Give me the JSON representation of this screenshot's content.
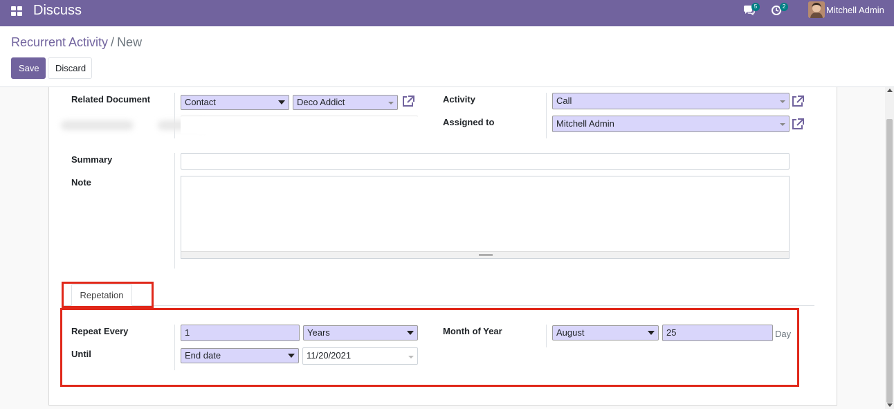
{
  "navbar": {
    "app_name": "Discuss",
    "messages_badge": "5",
    "activities_badge": "2",
    "user_name": "Mitchell Admin",
    "color": "#71639e"
  },
  "breadcrumb": {
    "parent": "Recurrent Activity",
    "separator": "/",
    "current": "New"
  },
  "buttons": {
    "save": "Save",
    "discard": "Discard"
  },
  "form": {
    "related_document": {
      "label": "Related Document",
      "model": "Contact",
      "record": "Deco Addict"
    },
    "activity": {
      "label": "Activity",
      "value": "Call"
    },
    "assigned_to": {
      "label": "Assigned to",
      "value": "Mitchell Admin"
    },
    "summary": {
      "label": "Summary",
      "value": ""
    },
    "note": {
      "label": "Note",
      "value": ""
    }
  },
  "tabs": [
    {
      "label": "Repetation"
    }
  ],
  "repetition": {
    "repeat_every": {
      "label": "Repeat Every",
      "interval": "1",
      "unit": "Years"
    },
    "until": {
      "label": "Until",
      "type": "End date",
      "date": "11/20/2021"
    },
    "month_of_year": {
      "label": "Month of Year",
      "month": "August",
      "day": "25",
      "day_label": "Day"
    }
  },
  "colors": {
    "highlight": "#e0281a",
    "required_field": "#d9d6fb"
  }
}
